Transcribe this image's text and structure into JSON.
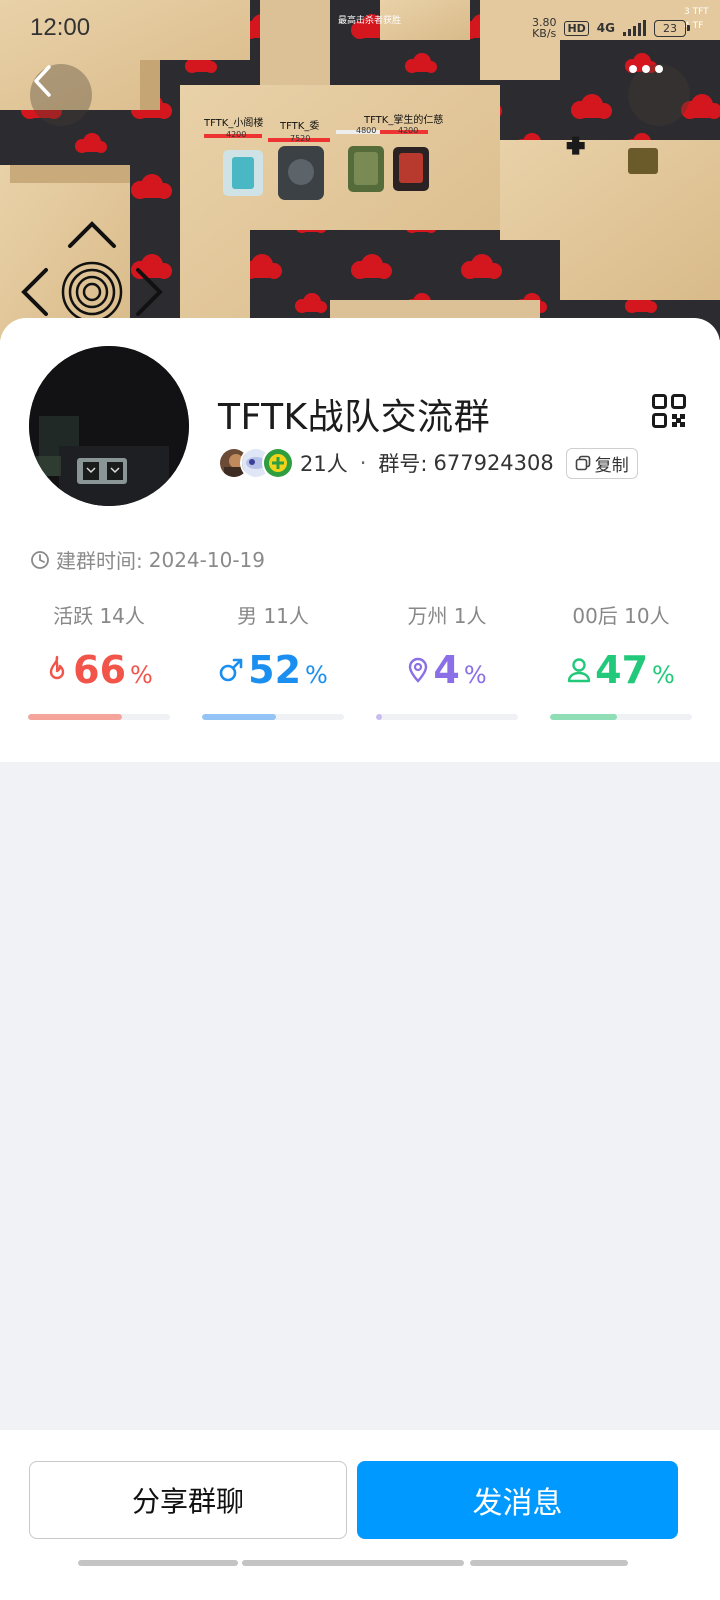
{
  "status_bar": {
    "time": "12:00",
    "net_speed_value": "3.80",
    "net_speed_unit": "KB/s",
    "hd": "HD",
    "network": "4G",
    "battery": "23"
  },
  "banner": {
    "top_text": "最高击杀者获胜",
    "player_tags": [
      "TFTK_小阁楼",
      "TFTK_委",
      "TFTK_掌生的仁慈"
    ],
    "hp_values": [
      "4200",
      "7520",
      "4800",
      "4200"
    ],
    "corner_text": [
      "3 TFT",
      "4 TF"
    ]
  },
  "group": {
    "name": "TFTK战队交流群",
    "member_count": "21人",
    "separator": "·",
    "group_no_label": "群号:",
    "group_no": "677924308",
    "copy_label": "复制",
    "created_label": "建群时间:",
    "created_date": "2024-10-19"
  },
  "stats": [
    {
      "label": "活跃 14人",
      "value": "66",
      "unit": "%",
      "fraction": 0.66,
      "color": "#f2544a",
      "bar_color": "#f5a49c",
      "icon": "flame-icon"
    },
    {
      "label": "男 11人",
      "value": "52",
      "unit": "%",
      "fraction": 0.52,
      "color": "#1a8ff0",
      "bar_color": "#93c4f5",
      "icon": "male-icon"
    },
    {
      "label": "万州 1人",
      "value": "4",
      "unit": "%",
      "fraction": 0.04,
      "color": "#8b6fe6",
      "bar_color": "#c8baf2",
      "icon": "location-pin-icon"
    },
    {
      "label": "00后 10人",
      "value": "47",
      "unit": "%",
      "fraction": 0.47,
      "color": "#23c97a",
      "bar_color": "#8fdeb6",
      "icon": "person-icon"
    }
  ],
  "actions": {
    "share_label": "分享群聊",
    "send_label": "发消息"
  },
  "colors": {
    "primary": "#0099ff",
    "background": "#f1f2f6"
  }
}
